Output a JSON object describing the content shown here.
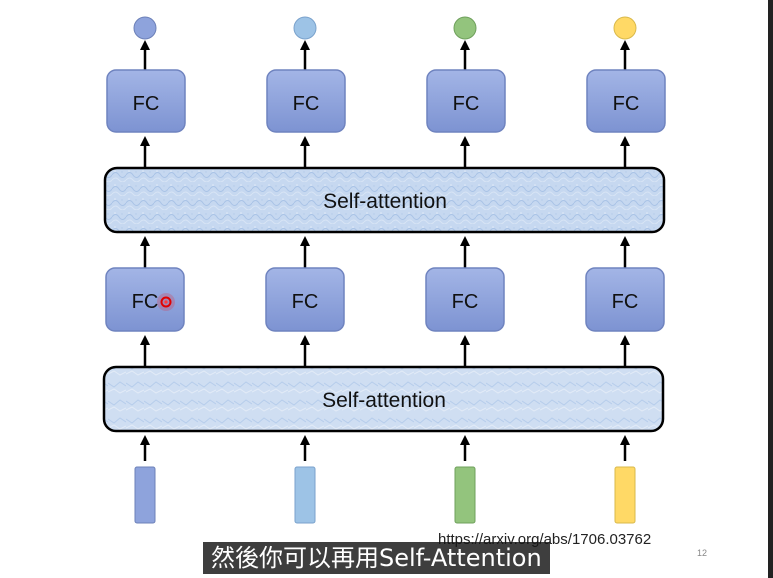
{
  "diagram": {
    "fc_label": "FC",
    "attention_label": "Self-attention",
    "top_output_colors": [
      "#8ea3dc",
      "#9dc3e6",
      "#93c47d",
      "#ffd966"
    ],
    "input_colors": [
      "#8ea3dc",
      "#9dc3e6",
      "#93c47d",
      "#ffd966"
    ],
    "fc_fill": "#8ea3dc",
    "attention_fill": "#c9dbf0"
  },
  "reference": {
    "url": "https://arxiv.org/abs/1706.03762",
    "page_number": "12"
  },
  "caption": {
    "subtitle": "然後你可以再用Self-Attention"
  }
}
